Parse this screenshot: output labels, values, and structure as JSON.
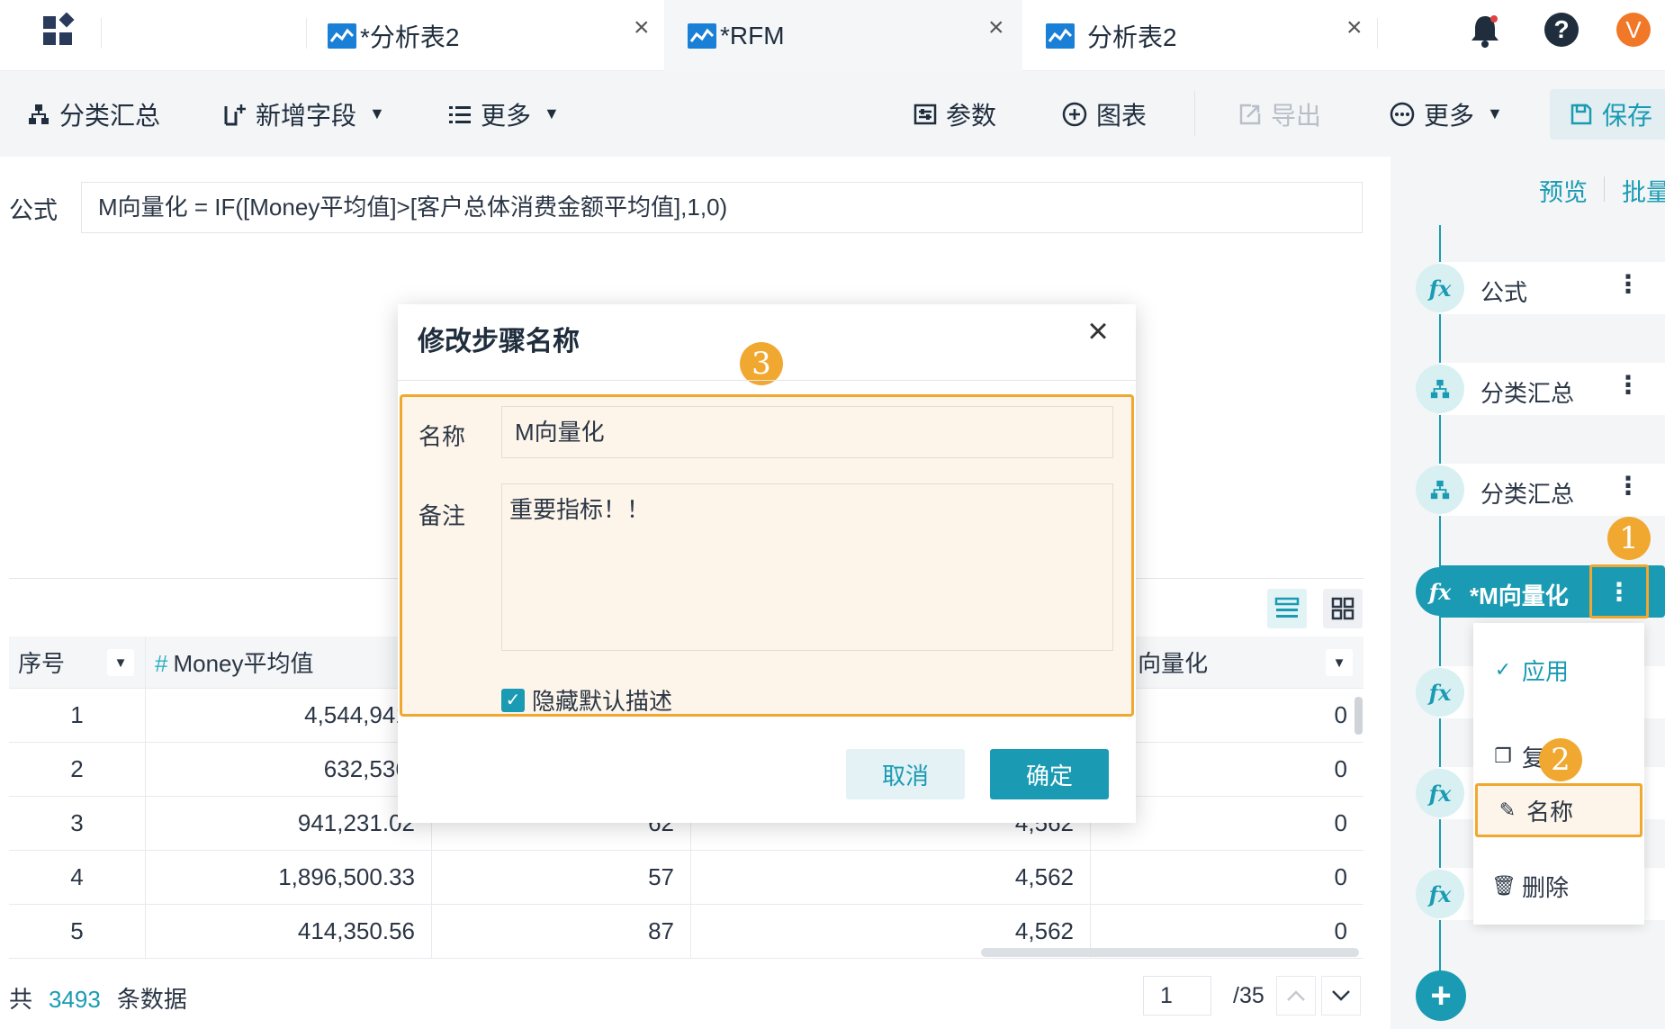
{
  "app": {
    "accent_color": "#1a9bb3",
    "highlight_color": "#f0a830"
  },
  "tabs": [
    {
      "label": "*分析表2",
      "icon": "chart-icon",
      "active": false
    },
    {
      "label": "*RFM",
      "icon": "chart-icon",
      "active": true
    },
    {
      "label": "分析表2",
      "icon": "chart-icon",
      "active": false
    }
  ],
  "user": {
    "avatar_letter": "V"
  },
  "toolbar": {
    "group_summary": "分类汇总",
    "add_field": "新增字段",
    "more_left": "更多",
    "params": "参数",
    "chart": "图表",
    "export": "导出",
    "more_right": "更多",
    "save": "保存"
  },
  "formula": {
    "label": "公式",
    "value": "M向量化 = IF([Money平均值]>[客户总体消费金额平均值],1,0)"
  },
  "table": {
    "headers": [
      "序号",
      "Money平均值",
      "",
      "",
      "M向量化"
    ],
    "rows": [
      [
        "1",
        "4,544,941.",
        "",
        "",
        "0"
      ],
      [
        "2",
        "632,536.",
        "",
        "",
        "0"
      ],
      [
        "3",
        "941,231.02",
        "62",
        "4,562",
        "0"
      ],
      [
        "4",
        "1,896,500.33",
        "57",
        "4,562",
        "0"
      ],
      [
        "5",
        "414,350.56",
        "87",
        "4,562",
        "0"
      ]
    ]
  },
  "footer": {
    "prefix": "共",
    "count": "3493",
    "suffix": "条数据",
    "page": "1",
    "total_pages": "/35"
  },
  "right_panel": {
    "preview": "预览",
    "batch": "批量",
    "steps": [
      {
        "label": "公式",
        "icon": "fx-icon"
      },
      {
        "label": "分类汇总",
        "icon": "group-icon"
      },
      {
        "label": "分类汇总",
        "icon": "group-icon"
      },
      {
        "label": "*M向量化",
        "icon": "fx-icon",
        "active": true
      },
      {
        "label": "",
        "icon": "fx-icon"
      },
      {
        "label": "",
        "icon": "fx-icon"
      },
      {
        "label": "",
        "icon": "fx-icon"
      }
    ]
  },
  "context_menu": {
    "items": [
      {
        "label": "应用",
        "icon": "check-icon"
      },
      {
        "label": "复制",
        "icon": "copy-icon"
      },
      {
        "label": "名称",
        "icon": "edit-icon"
      },
      {
        "label": "删除",
        "icon": "trash-icon"
      }
    ]
  },
  "badges": [
    "1",
    "2",
    "3"
  ],
  "dialog": {
    "title": "修改步骤名称",
    "name_label": "名称",
    "name_value": "M向量化",
    "note_label": "备注",
    "note_value": "重要指标！！",
    "hide_label": "隐藏默认描述",
    "hide_checked": true,
    "cancel": "取消",
    "ok": "确定"
  }
}
